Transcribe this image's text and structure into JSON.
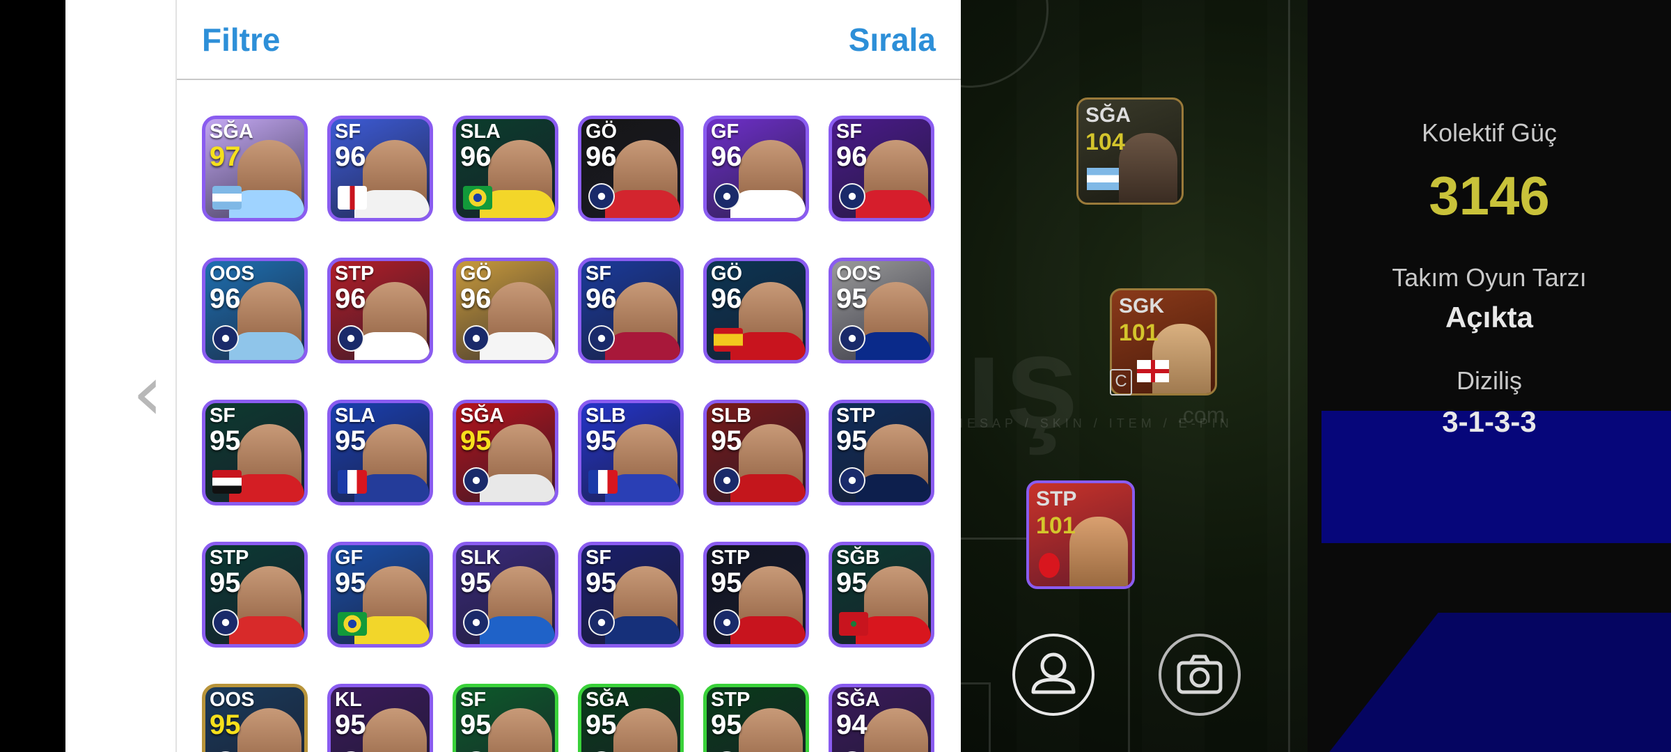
{
  "header": {
    "filter_label": "Filtre",
    "sort_label": "Sırala"
  },
  "nav": {
    "back_glyph": "‹"
  },
  "team": {
    "power_label": "Kolektif Güç",
    "power_value": "3146",
    "style_label": "Takım Oyun Tarzı",
    "style_value": "Açıkta",
    "formation_label": "Diziliş",
    "formation_value": "3-1-3-3"
  },
  "field_cards": [
    {
      "position": "SĞA",
      "rating": "104"
    },
    {
      "position": "SGK",
      "rating": "101"
    },
    {
      "position": "STP",
      "rating": "101"
    }
  ],
  "player_cards": [
    {
      "position": "SĞA",
      "rating": "97",
      "gold": true,
      "bg": "#c3a7f2",
      "jersey": "#9fd3ff",
      "badge": "flag-argentina"
    },
    {
      "position": "SF",
      "rating": "96",
      "gold": false,
      "bg": "#3d5bd6",
      "jersey": "#f2f2f2",
      "badge": "flag-england"
    },
    {
      "position": "SLA",
      "rating": "96",
      "gold": false,
      "bg": "#0b3d2c",
      "jersey": "#f3d629",
      "badge": "flag-brazil"
    },
    {
      "position": "GÖ",
      "rating": "96",
      "gold": false,
      "bg": "#161616",
      "jersey": "#d3252e",
      "badge": "club-crest"
    },
    {
      "position": "GF",
      "rating": "96",
      "gold": false,
      "bg": "#6e2fc9",
      "jersey": "#ffffff",
      "badge": "club-crest"
    },
    {
      "position": "SF",
      "rating": "96",
      "gold": false,
      "bg": "#4a1a8a",
      "jersey": "#d61e2c",
      "badge": "club-crest"
    },
    {
      "position": "OOS",
      "rating": "96",
      "gold": false,
      "bg": "#1e6fb0",
      "jersey": "#8fc5ea",
      "badge": "club-crest"
    },
    {
      "position": "STP",
      "rating": "96",
      "gold": false,
      "bg": "#b21e28",
      "jersey": "#ffffff",
      "badge": "club-crest"
    },
    {
      "position": "GÖ",
      "rating": "96",
      "gold": false,
      "bg": "#c89a3c",
      "jersey": "#f5f5f5",
      "badge": "club-crest"
    },
    {
      "position": "SF",
      "rating": "96",
      "gold": false,
      "bg": "#1a3a9a",
      "jersey": "#a8183a",
      "badge": "club-crest"
    },
    {
      "position": "GÖ",
      "rating": "96",
      "gold": false,
      "bg": "#0b3553",
      "jersey": "#c8141e",
      "badge": "flag-spain"
    },
    {
      "position": "OOS",
      "rating": "95",
      "gold": false,
      "bg": "#9a9a9a",
      "jersey": "#0a2a8a",
      "badge": "club-crest"
    },
    {
      "position": "SF",
      "rating": "95",
      "gold": false,
      "bg": "#0d3a30",
      "jersey": "#d41e24",
      "badge": "flag-egypt"
    },
    {
      "position": "SLA",
      "rating": "95",
      "gold": false,
      "bg": "#1a3fb0",
      "jersey": "#243c9a",
      "badge": "flag-france"
    },
    {
      "position": "SĞA",
      "rating": "95",
      "gold": true,
      "bg": "#b5141c",
      "jersey": "#e8e8e8",
      "badge": "club-crest"
    },
    {
      "position": "SLB",
      "rating": "95",
      "gold": false,
      "bg": "#2434c8",
      "jersey": "#2a3fb5",
      "badge": "flag-france"
    },
    {
      "position": "SLB",
      "rating": "95",
      "gold": false,
      "bg": "#7a1a1a",
      "jersey": "#c4161c",
      "badge": "club-crest"
    },
    {
      "position": "STP",
      "rating": "95",
      "gold": false,
      "bg": "#0f2d5a",
      "jersey": "#0d1f4d",
      "badge": "club-crest"
    },
    {
      "position": "STP",
      "rating": "95",
      "gold": false,
      "bg": "#0b3a34",
      "jersey": "#d82a2a",
      "badge": "club-crest"
    },
    {
      "position": "GF",
      "rating": "95",
      "gold": false,
      "bg": "#1a4fa8",
      "jersey": "#f2d62a",
      "badge": "flag-brazil"
    },
    {
      "position": "SLK",
      "rating": "95",
      "gold": false,
      "bg": "#3a2a7a",
      "jersey": "#1f62c8",
      "badge": "club-crest"
    },
    {
      "position": "SF",
      "rating": "95",
      "gold": false,
      "bg": "#1a1f6a",
      "jersey": "#16307a",
      "badge": "club-crest"
    },
    {
      "position": "STP",
      "rating": "95",
      "gold": false,
      "bg": "#121624",
      "jersey": "#c8141e",
      "badge": "club-crest"
    },
    {
      "position": "SĞB",
      "rating": "95",
      "gold": false,
      "bg": "#0c3a30",
      "jersey": "#d8161e",
      "badge": "flag-morocco"
    },
    {
      "position": "OOS",
      "rating": "95",
      "gold": true,
      "bg": "#1a3a5a",
      "jersey": "#3a3a8a",
      "badge": "club-crest"
    },
    {
      "position": "KL",
      "rating": "95",
      "gold": false,
      "bg": "#3a1a5a",
      "jersey": "#cf1e3a",
      "badge": "club-crest"
    },
    {
      "position": "SF",
      "rating": "95",
      "gold": false,
      "bg": "#0d5a2a",
      "jersey": "#f2f2f2",
      "badge": "club-crest"
    },
    {
      "position": "SĞA",
      "rating": "95",
      "gold": false,
      "bg": "#0a3a1a",
      "jersey": "#c8141e",
      "badge": "club-crest"
    },
    {
      "position": "STP",
      "rating": "95",
      "gold": false,
      "bg": "#0a3a1a",
      "jersey": "#c8141e",
      "badge": "club-crest"
    },
    {
      "position": "SĞA",
      "rating": "94",
      "gold": false,
      "bg": "#3a1a5a",
      "jersey": "#7a1a2a",
      "badge": "club-crest"
    }
  ],
  "watermark": {
    "text": "satış",
    "sub": "HESAP / SKIN / ITEM / E-PIN",
    "com": ".com"
  },
  "colors": {
    "accent": "#2d8fd8",
    "power": "#c9c23a",
    "gold_rating": "#f6e01c"
  }
}
